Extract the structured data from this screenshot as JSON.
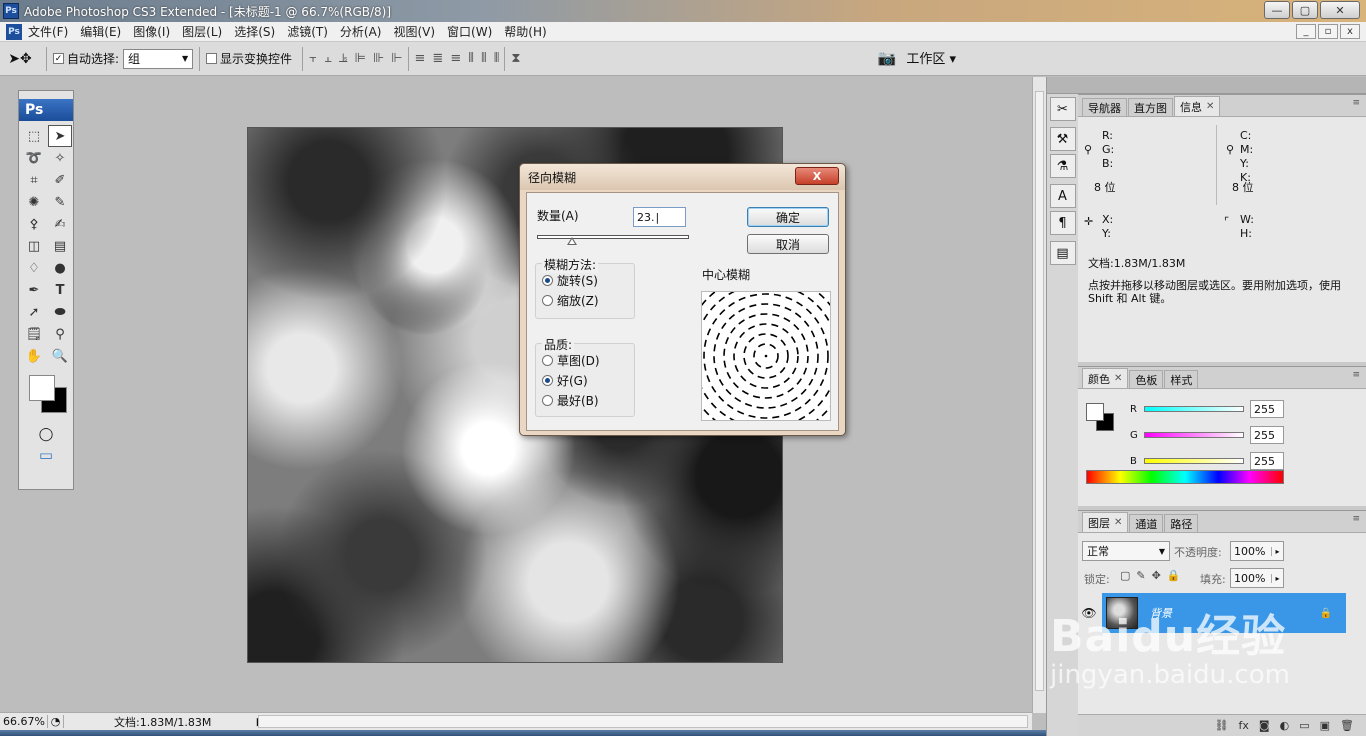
{
  "window": {
    "title": "Adobe Photoshop CS3 Extended - [未标题-1 @ 66.7%(RGB/8)]",
    "ps_icon": "Ps"
  },
  "window_buttons": {
    "minimize": "—",
    "maximize": "▢",
    "close": "✕"
  },
  "doc_buttons": {
    "minimize": "_",
    "restore": "▫",
    "close": "x"
  },
  "menu": [
    "文件(F)",
    "编辑(E)",
    "图像(I)",
    "图层(L)",
    "选择(S)",
    "滤镜(T)",
    "分析(A)",
    "视图(V)",
    "窗口(W)",
    "帮助(H)"
  ],
  "options": {
    "auto_select_label": "自动选择:",
    "auto_select_value": "组",
    "show_transform_label": "显示变换控件",
    "workspace_label": "工作区 ▾"
  },
  "toolbox": {
    "header": "Ps"
  },
  "dialog": {
    "title": "径向模糊",
    "close_label": "X",
    "amount_label": "数量(A)",
    "amount_value": "23.",
    "ok_label": "确定",
    "cancel_label": "取消",
    "blur_method_label": "模糊方法:",
    "method_spin": "旋转(S)",
    "method_zoom": "缩放(Z)",
    "quality_label": "品质:",
    "quality_draft": "草图(D)",
    "quality_good": "好(G)",
    "quality_best": "最好(B)",
    "center_label": "中心模糊",
    "amount_fraction": 0.23,
    "selected_method": "spin",
    "selected_quality": "good"
  },
  "status": {
    "zoom": "66.67%",
    "doc": "文档:1.83M/1.83M"
  },
  "info_panel": {
    "tabs": [
      "导航器",
      "直方图",
      "信息"
    ],
    "r": "R:",
    "g": "G:",
    "b": "B:",
    "c": "C:",
    "m": "M:",
    "y": "Y:",
    "k": "K:",
    "bits_left": "8 位",
    "bits_right": "8 位",
    "x": "X:",
    "y2": "Y:",
    "w": "W:",
    "h": "H:",
    "doc": "文档:1.83M/1.83M",
    "hint": "点按并拖移以移动图层或选区。要用附加选项，使用 Shift 和 Alt 键。"
  },
  "color_panel": {
    "tabs": [
      "颜色",
      "色板",
      "样式"
    ],
    "r_label": "R",
    "g_label": "G",
    "b_label": "B",
    "r_value": "255",
    "g_value": "255",
    "b_value": "255"
  },
  "layers_panel": {
    "tabs": [
      "图层",
      "通道",
      "路径"
    ],
    "blend_mode": "正常",
    "opacity_label": "不透明度:",
    "opacity_value": "100%",
    "lock_label": "锁定:",
    "fill_label": "填充:",
    "fill_value": "100%",
    "layer_name": "背景"
  },
  "watermark": {
    "line1": "Baidu经验",
    "line2": "jingyan.baidu.com"
  },
  "colors": {
    "selection": "#3a97e8",
    "dialog_frame": "#e9d7c4"
  }
}
